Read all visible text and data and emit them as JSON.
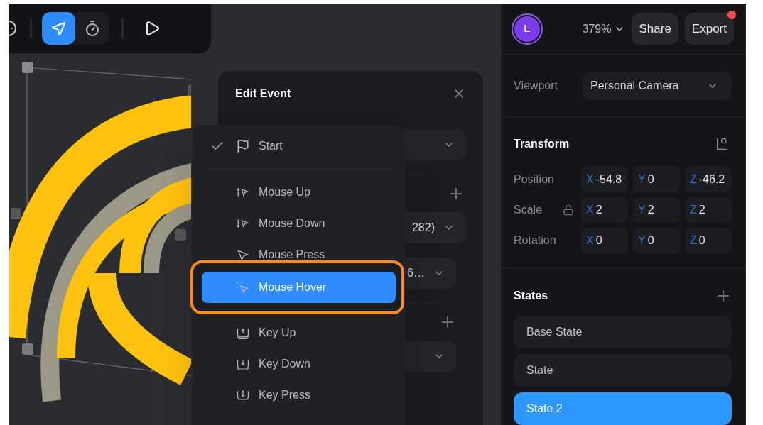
{
  "toolbar": {
    "tools": [
      {
        "selected": true
      },
      {
        "selected": false
      }
    ]
  },
  "dialog": {
    "title": "Edit Event",
    "fields": [
      {
        "kind": "select"
      },
      {
        "kind": "add"
      },
      {
        "kind": "select",
        "value": "282)"
      },
      {
        "kind": "select",
        "value": "6…"
      },
      {
        "kind": "add"
      },
      {
        "kind": "select"
      }
    ]
  },
  "event_menu": {
    "groups": [
      [
        {
          "label": "Start",
          "checked": true,
          "selected": false,
          "highlighted": false
        }
      ],
      [
        {
          "label": "Mouse Up",
          "checked": false,
          "selected": false,
          "highlighted": false
        },
        {
          "label": "Mouse Down",
          "checked": false,
          "selected": false,
          "highlighted": false
        },
        {
          "label": "Mouse Press",
          "checked": false,
          "selected": false,
          "highlighted": false
        },
        {
          "label": "Mouse Hover",
          "checked": false,
          "selected": true,
          "highlighted": true
        },
        {
          "label": "Key Up",
          "checked": false,
          "selected": false,
          "highlighted": false
        },
        {
          "label": "Key Down",
          "checked": false,
          "selected": false,
          "highlighted": false
        },
        {
          "label": "Key Press",
          "checked": false,
          "selected": false,
          "highlighted": false
        }
      ]
    ]
  },
  "panel": {
    "avatar": "L",
    "zoom": "379%",
    "buttons": [
      {
        "label": "Share",
        "notification": false
      },
      {
        "label": "Export",
        "notification": true
      }
    ],
    "viewport": {
      "label": "Viewport",
      "value": "Personal Camera"
    },
    "transform": {
      "title": "Transform",
      "rows": [
        {
          "label": "Position",
          "locked": null,
          "fields": [
            {
              "axis": "X",
              "value": "-54.8"
            },
            {
              "axis": "Y",
              "value": "0"
            },
            {
              "axis": "Z",
              "value": "-46.2"
            }
          ]
        },
        {
          "label": "Scale",
          "locked": false,
          "fields": [
            {
              "axis": "X",
              "value": "2"
            },
            {
              "axis": "Y",
              "value": "2"
            },
            {
              "axis": "Z",
              "value": "2"
            }
          ]
        },
        {
          "label": "Rotation",
          "locked": null,
          "fields": [
            {
              "axis": "X",
              "value": "0"
            },
            {
              "axis": "Y",
              "value": "0"
            },
            {
              "axis": "Z",
              "value": "0"
            }
          ]
        }
      ]
    },
    "states": {
      "title": "States",
      "items": [
        {
          "label": "Base State",
          "selected": false
        },
        {
          "label": "State",
          "selected": false
        },
        {
          "label": "State 2",
          "selected": true
        }
      ]
    }
  }
}
